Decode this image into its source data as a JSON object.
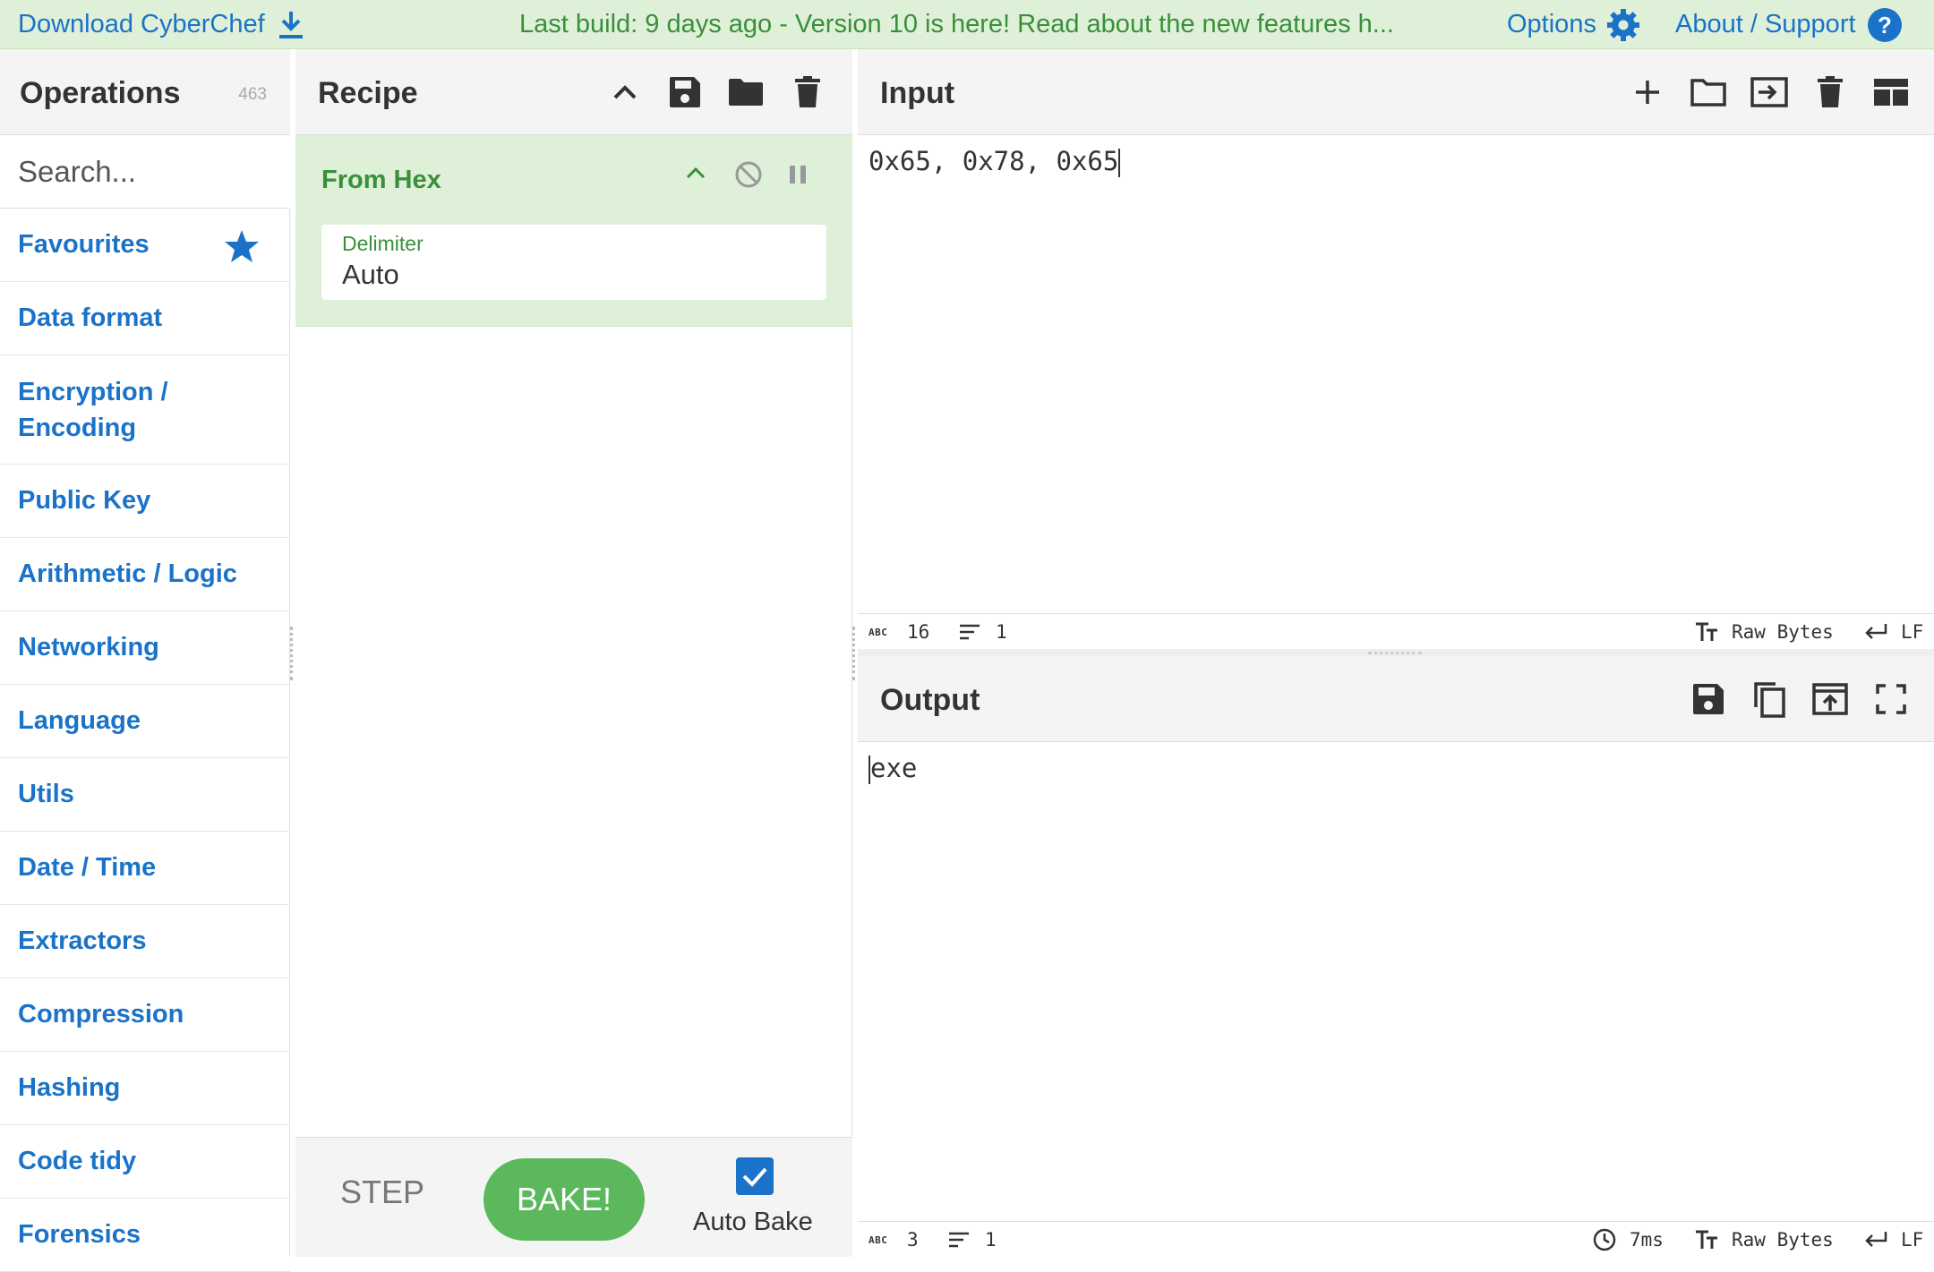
{
  "banner": {
    "download_label": "Download CyberChef",
    "build_message": "Last build: 9 days ago - Version 10 is here! Read about the new features h...",
    "options_label": "Options",
    "about_label": "About / Support"
  },
  "operations": {
    "title": "Operations",
    "count": "463",
    "search_placeholder": "Search...",
    "categories": [
      {
        "label": "Favourites"
      },
      {
        "label": "Data format"
      },
      {
        "label": "Encryption / Encoding"
      },
      {
        "label": "Public Key"
      },
      {
        "label": "Arithmetic / Logic"
      },
      {
        "label": "Networking"
      },
      {
        "label": "Language"
      },
      {
        "label": "Utils"
      },
      {
        "label": "Date / Time"
      },
      {
        "label": "Extractors"
      },
      {
        "label": "Compression"
      },
      {
        "label": "Hashing"
      },
      {
        "label": "Code tidy"
      },
      {
        "label": "Forensics"
      }
    ]
  },
  "recipe": {
    "title": "Recipe",
    "operation": {
      "name": "From Hex",
      "field_label": "Delimiter",
      "field_value": "Auto"
    },
    "step_label": "STEP",
    "bake_label": "BAKE!",
    "auto_bake_label": "Auto Bake",
    "auto_bake_checked": true
  },
  "input": {
    "title": "Input",
    "text": "0x65, 0x78, 0x65",
    "status": {
      "chars": "16",
      "lines": "1",
      "encoding": "Raw Bytes",
      "eol": "LF"
    }
  },
  "output": {
    "title": "Output",
    "text": "exe",
    "status": {
      "chars": "3",
      "lines": "1",
      "time": "7ms",
      "encoding": "Raw Bytes",
      "eol": "LF"
    }
  },
  "colors": {
    "accent_blue": "#1a73c8",
    "accent_green": "#3a8f3a",
    "banner_bg": "#dff0d8",
    "bake_green": "#5cb85c"
  }
}
